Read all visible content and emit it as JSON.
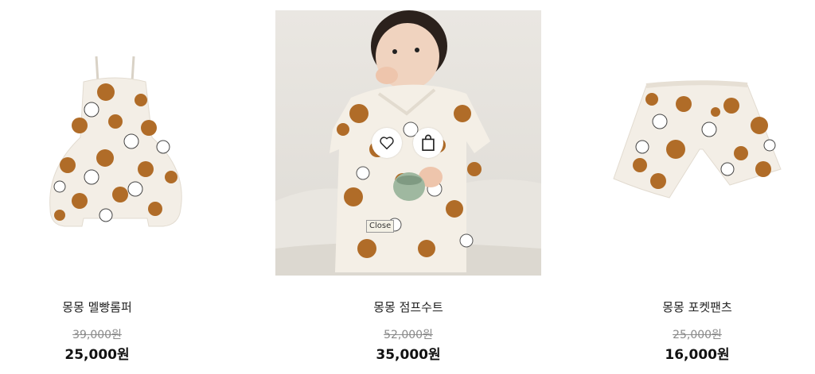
{
  "products": [
    {
      "name": "몽몽 멜빵롬퍼",
      "original_price": "39,000원",
      "sale_price": "25,000원"
    },
    {
      "name": "몽몽 점프수트",
      "original_price": "52,000원",
      "sale_price": "35,000원"
    },
    {
      "name": "몽몽 포켓팬츠",
      "original_price": "25,000원",
      "sale_price": "16,000원"
    }
  ],
  "hover_overlay": {
    "wishlist_icon": "heart-icon",
    "cart_icon": "shopping-bag-icon",
    "close_tooltip": "Close"
  },
  "colors": {
    "fabric": "#f3eee6",
    "pattern_brown": "#b06c28",
    "price_text": "#111111",
    "strike_text": "#8a8a8a"
  }
}
